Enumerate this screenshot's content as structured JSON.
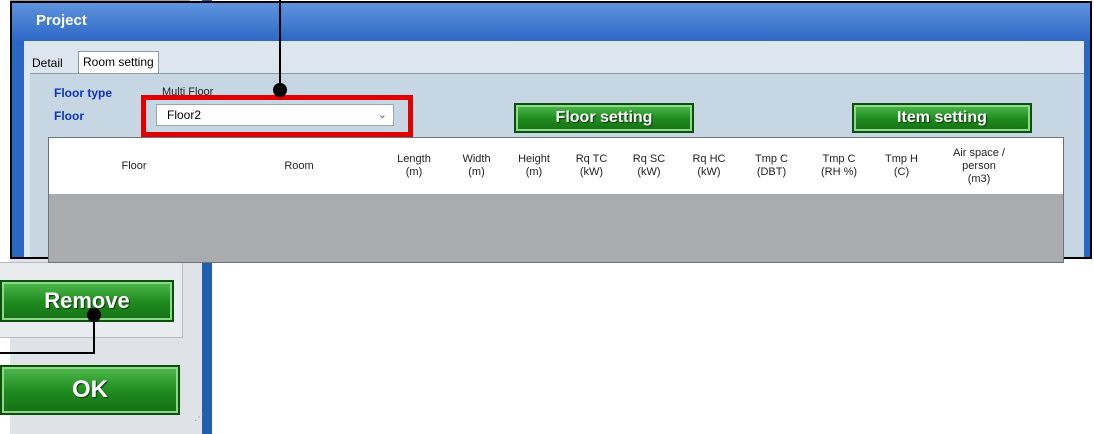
{
  "dialog": {
    "title": "Project"
  },
  "tabs": [
    {
      "label": "Detail"
    },
    {
      "label": "Room setting"
    }
  ],
  "floor_type": {
    "label": "Floor type",
    "value": "Multi Floor"
  },
  "floor": {
    "label": "Floor",
    "selected": "Floor2"
  },
  "buttons": {
    "floor_setting": "Floor setting",
    "item_setting": "Item setting",
    "remove": "Remove",
    "ok": "OK"
  },
  "grid_columns": [
    [
      "Floor"
    ],
    [
      "Room"
    ],
    [
      "Length",
      "(m)"
    ],
    [
      "Width",
      "(m)"
    ],
    [
      "Height",
      "(m)"
    ],
    [
      "Rq TC",
      "(kW)"
    ],
    [
      "Rq SC",
      "(kW)"
    ],
    [
      "Rq HC",
      "(kW)"
    ],
    [
      "Tmp C",
      "(DBT)"
    ],
    [
      "Tmp C",
      "(RH %)"
    ],
    [
      "Tmp H",
      "(C)"
    ],
    [
      "Air space /",
      "person",
      "(m3)"
    ]
  ]
}
